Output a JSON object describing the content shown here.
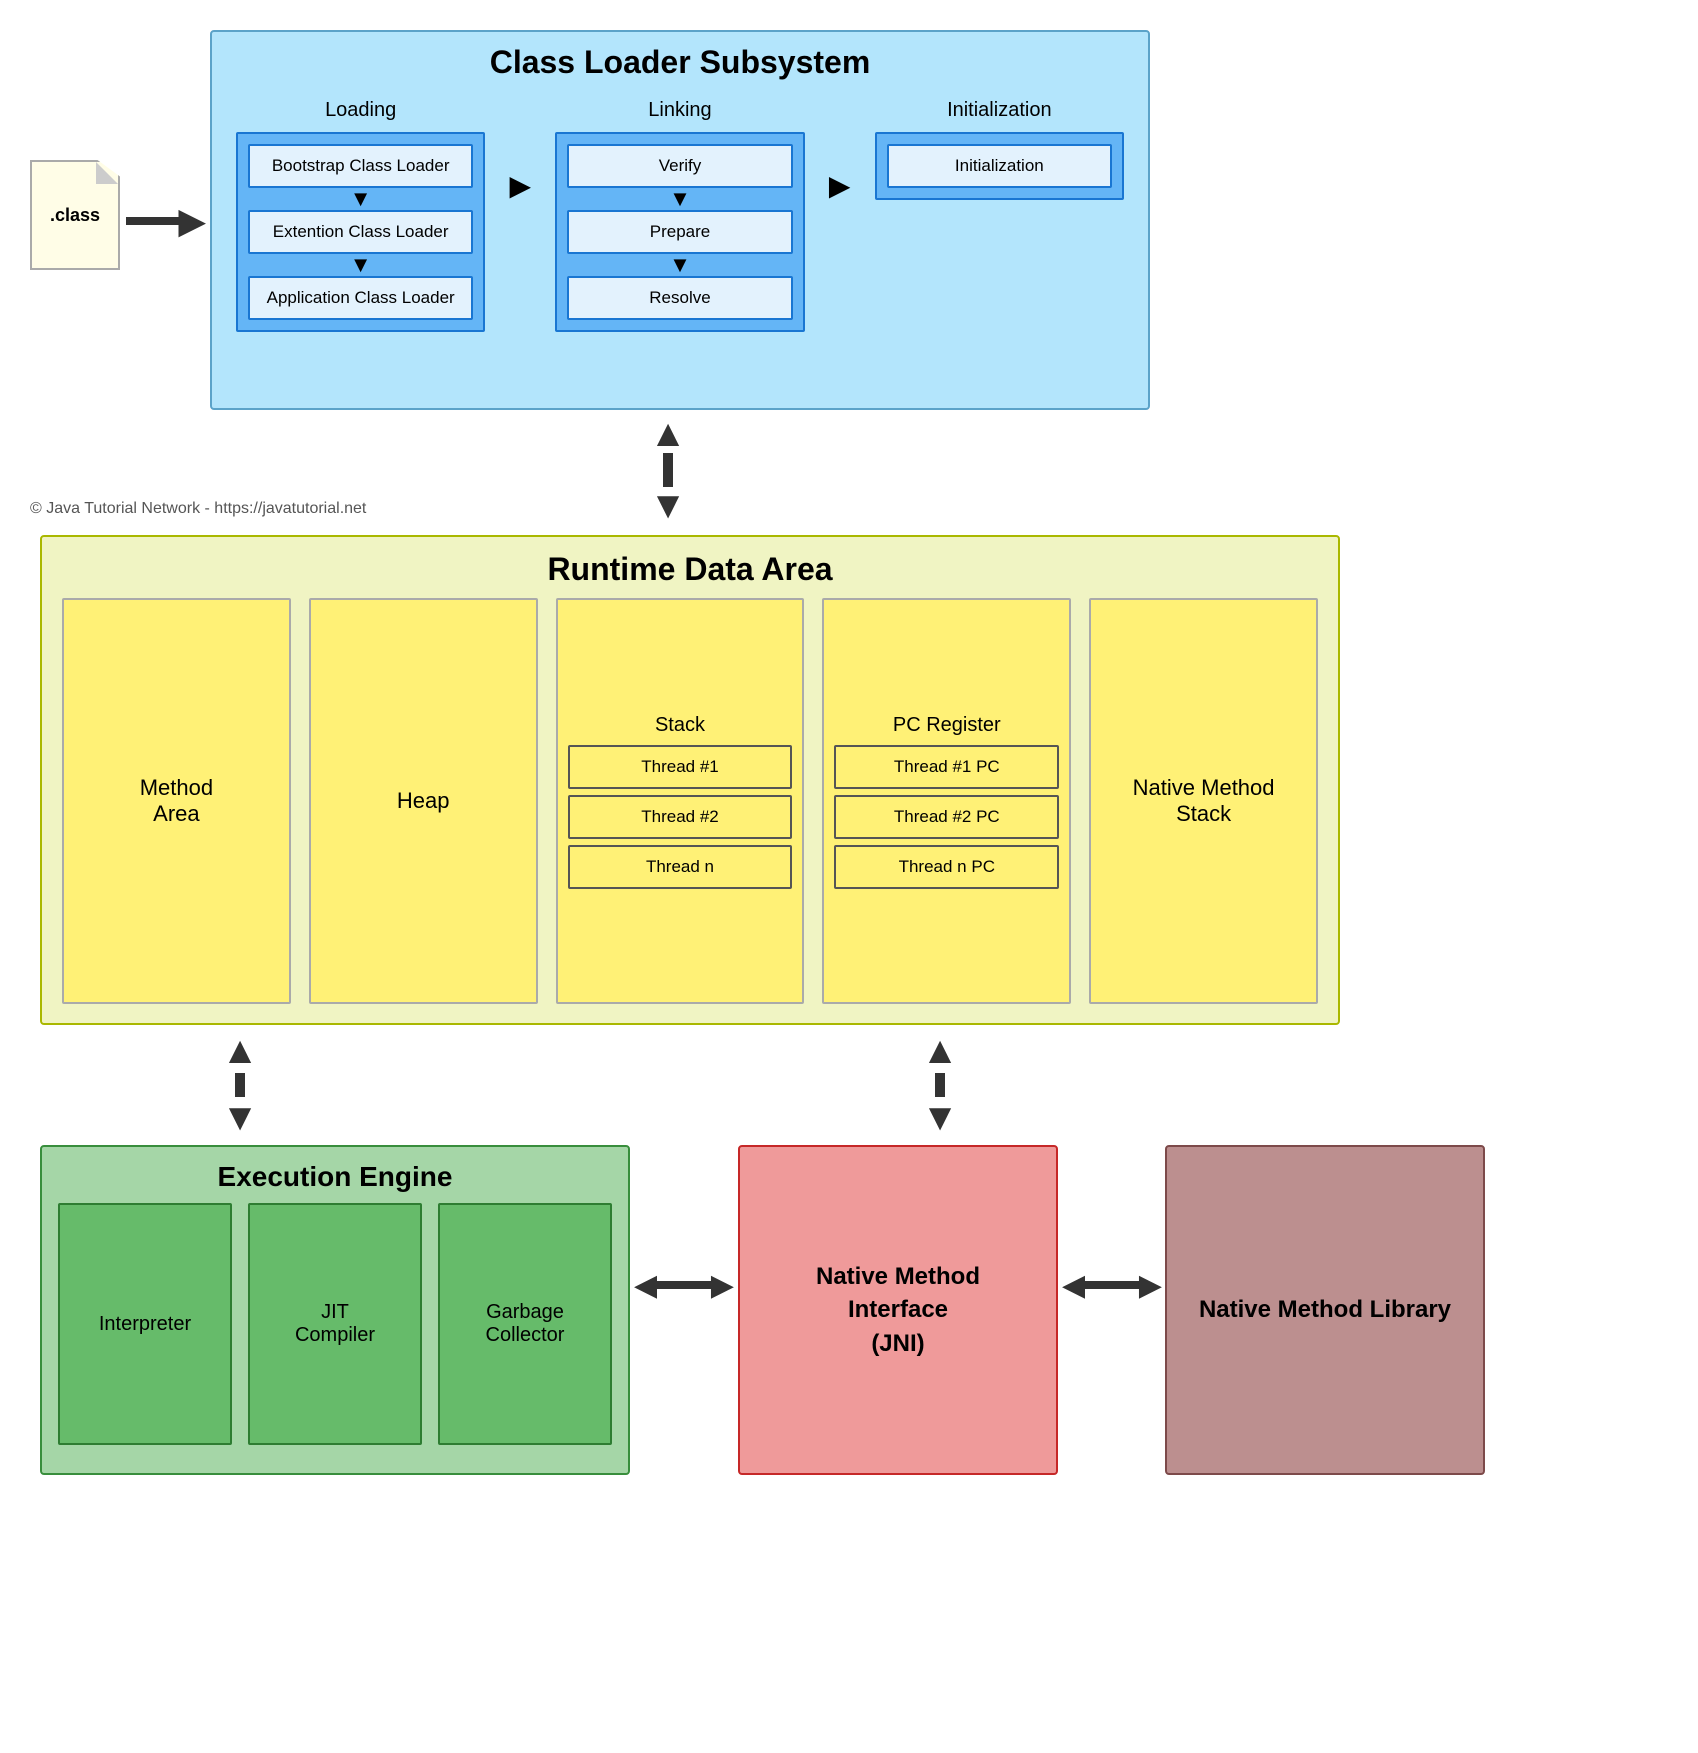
{
  "classFile": {
    "label": ".class"
  },
  "classLoaderSubsystem": {
    "title": "Class Loader Subsystem",
    "loading": {
      "label": "Loading",
      "boxes": [
        "Bootstrap Class Loader",
        "Extention Class Loader",
        "Application Class Loader"
      ]
    },
    "linking": {
      "label": "Linking",
      "boxes": [
        "Verify",
        "Prepare",
        "Resolve"
      ]
    },
    "initialization": {
      "label": "Initialization",
      "box": "Initialization"
    }
  },
  "copyright": "© Java Tutorial Network - https://javatutorial.net",
  "runtimeDataArea": {
    "title": "Runtime Data Area",
    "methodArea": "Method\nArea",
    "heap": "Heap",
    "stack": {
      "title": "Stack",
      "threads": [
        "Thread #1",
        "Thread #2",
        "Thread n"
      ]
    },
    "pcRegister": {
      "title": "PC Register",
      "threads": [
        "Thread #1 PC",
        "Thread #2 PC",
        "Thread n PC"
      ]
    },
    "nativeMethodStack": "Native Method\nStack"
  },
  "executionEngine": {
    "title": "Execution Engine",
    "boxes": [
      "Interpreter",
      "JIT\nCompiler",
      "Garbage\nCollector"
    ]
  },
  "nativeMethodInterface": {
    "text": "Native Method\nInterface\n(JNI)"
  },
  "nativeMethodLibrary": {
    "text": "Native Method\nLibrary"
  }
}
